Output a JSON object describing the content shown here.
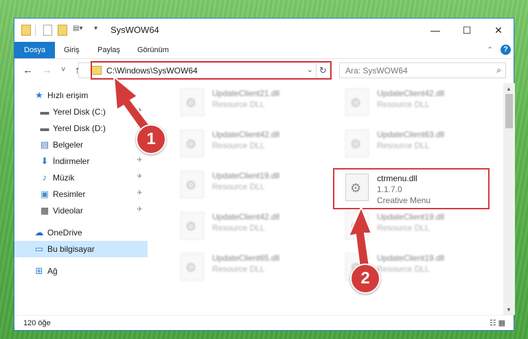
{
  "window": {
    "title": "SysWOW64",
    "controls": {
      "minimize": "—",
      "maximize": "☐",
      "close": "✕"
    }
  },
  "ribbon": {
    "tabs": [
      "Dosya",
      "Giriş",
      "Paylaş",
      "Görünüm"
    ],
    "collapse_glyph": "⌃",
    "help_glyph": "?"
  },
  "nav": {
    "back_glyph": "←",
    "forward_glyph": "→",
    "recent_glyph": "˅",
    "up_glyph": "↑",
    "address": "C:\\Windows\\SysWOW64",
    "address_dropdown_glyph": "⌄",
    "refresh_glyph": "↻",
    "search_placeholder": "Ara: SysWOW64",
    "search_glyph": "⌕"
  },
  "sidebar": {
    "items": [
      {
        "label": "Hızlı erişim",
        "icon": "star-icon",
        "glyph": "★",
        "color": "#2a7fd6"
      },
      {
        "label": "Yerel Disk (C:)",
        "icon": "drive-icon",
        "glyph": "▬",
        "color": "#666666",
        "pin": "✈"
      },
      {
        "label": "Yerel Disk (D:)",
        "icon": "drive-icon",
        "glyph": "▬",
        "color": "#666666",
        "pin": "✈"
      },
      {
        "label": "Belgeler",
        "icon": "document-icon",
        "glyph": "▤",
        "color": "#4a74b8",
        "pin": "✈"
      },
      {
        "label": "İndirmeler",
        "icon": "download-icon",
        "glyph": "⬇",
        "color": "#2a7fd6",
        "pin": "✈"
      },
      {
        "label": "Müzik",
        "icon": "music-icon",
        "glyph": "♪",
        "color": "#2a7fd6",
        "pin": "✈"
      },
      {
        "label": "Resimler",
        "icon": "pictures-icon",
        "glyph": "▣",
        "color": "#4a90c8",
        "pin": "✈"
      },
      {
        "label": "Videolar",
        "icon": "video-icon",
        "glyph": "▦",
        "color": "#444444",
        "pin": "✈"
      },
      {
        "label": "OneDrive",
        "icon": "cloud-icon",
        "glyph": "☁",
        "color": "#1e6fc8"
      },
      {
        "label": "Bu bilgisayar",
        "icon": "computer-icon",
        "glyph": "▭",
        "color": "#2a7fd6"
      },
      {
        "label": "Ağ",
        "icon": "network-icon",
        "glyph": "⊞",
        "color": "#2a7fd6"
      }
    ]
  },
  "files": {
    "gear_glyph": "⚙",
    "left_column": [
      {
        "name": "UpdateClient21.dll",
        "type": "Resource DLL"
      },
      {
        "name": "UpdateClient42.dll",
        "type": "Resource DLL"
      },
      {
        "name": "UpdateClient19.dll",
        "type": "Resource DLL"
      },
      {
        "name": "UpdateClient42.dll",
        "type": "Resource DLL"
      },
      {
        "name": "UpdateClient65.dll",
        "type": "Resource DLL"
      }
    ],
    "right_column": [
      {
        "name": "UpdateClient42.dll",
        "type": "Resource DLL"
      },
      {
        "name": "UpdateClient63.dll",
        "type": "Resource DLL"
      },
      {
        "name": "UpdateClient19.dll",
        "type": "Resource DLL"
      },
      {
        "name": "UpdateClient19.dll",
        "type": "Resource DLL"
      }
    ],
    "highlighted": {
      "name": "ctrmenu.dll",
      "version": "1.1.7.0",
      "description": "Creative Menu"
    }
  },
  "scrollbar": {
    "up_glyph": "▲",
    "down_glyph": "▼"
  },
  "status": {
    "count": "120 öğe",
    "view_glyphs": "☷ ▦"
  },
  "annotations": {
    "step1": "1",
    "step2": "2",
    "color": "#d33b3b"
  }
}
